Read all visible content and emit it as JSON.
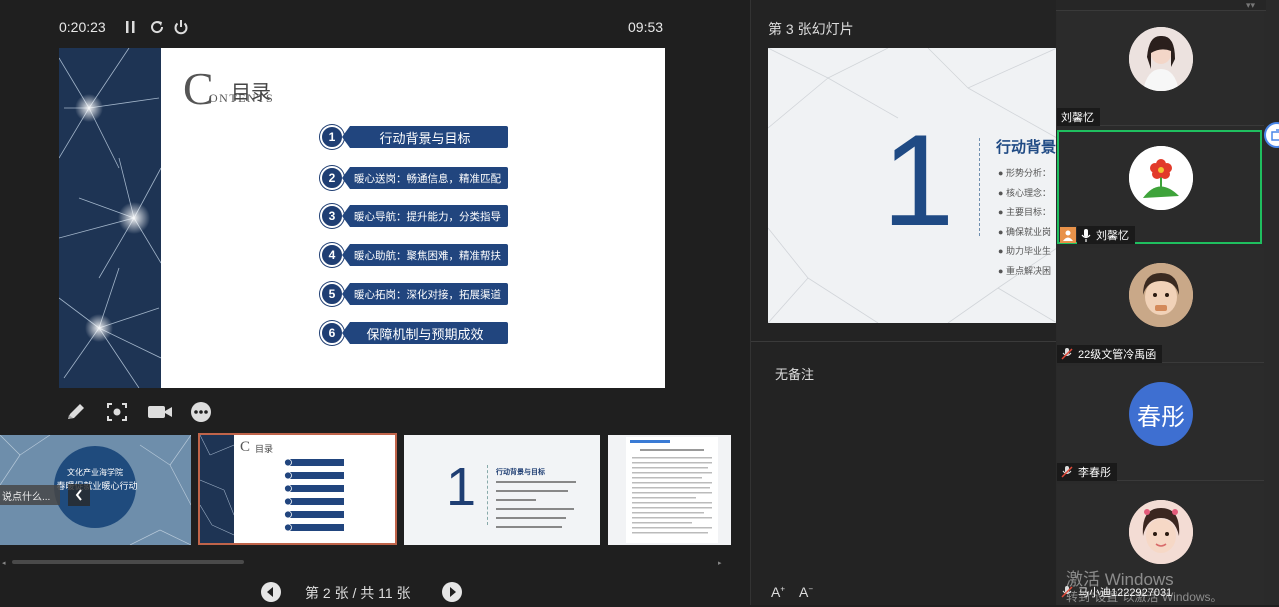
{
  "presenter": {
    "elapsed": "0:20:23",
    "clock": "09:53",
    "slide_position": "第 2 张 / 共 11 张"
  },
  "main_slide": {
    "contents_letter": "C",
    "contents_rest": "ONTENTS",
    "title": "目录",
    "items": [
      {
        "num": "1",
        "label": "行动背景与目标"
      },
      {
        "num": "2",
        "label": "暖心送岗：畅通信息，精准匹配"
      },
      {
        "num": "3",
        "label": "暖心导航：提升能力，分类指导"
      },
      {
        "num": "4",
        "label": "暖心助航：聚焦困难，精准帮扶"
      },
      {
        "num": "5",
        "label": "暖心拓岗：深化对接，拓展渠道"
      },
      {
        "num": "6",
        "label": "保障机制与预期成效"
      }
    ]
  },
  "thumbnails": {
    "t1_line1": "文化产业海学院",
    "t1_line2": "春暖促就业暖心行动",
    "t1_comment_placeholder": "说点什么...",
    "t3_title": "行动背景与目标",
    "t2_title": "目录"
  },
  "next_slide": {
    "header": "第 3 张幻灯片",
    "number": "1",
    "title": "行动背景",
    "bullets": [
      "形势分析：",
      "核心理念：",
      "主要目标：",
      "确保就业岗",
      "助力毕业生",
      "重点解决困"
    ]
  },
  "notes": {
    "text": "无备注",
    "font_increase": "A",
    "font_decrease": "A"
  },
  "participants": [
    {
      "name": "刘馨忆"
    },
    {
      "name": "刘馨忆"
    },
    {
      "name": "22级文管冷禹函"
    },
    {
      "name": "李春彤",
      "avatar_text": "春彤"
    },
    {
      "name": "马小迪1222927031"
    }
  ],
  "watermark": {
    "line1": "激活 Windows",
    "line2": "转到\"设置\"以激活 Windows。"
  },
  "colors": {
    "accent_navy": "#21457e",
    "active_speaker_border": "#1fbf5f",
    "selected_thumb_border": "#c0644a",
    "avatar_blue": "#3e6fd1"
  }
}
